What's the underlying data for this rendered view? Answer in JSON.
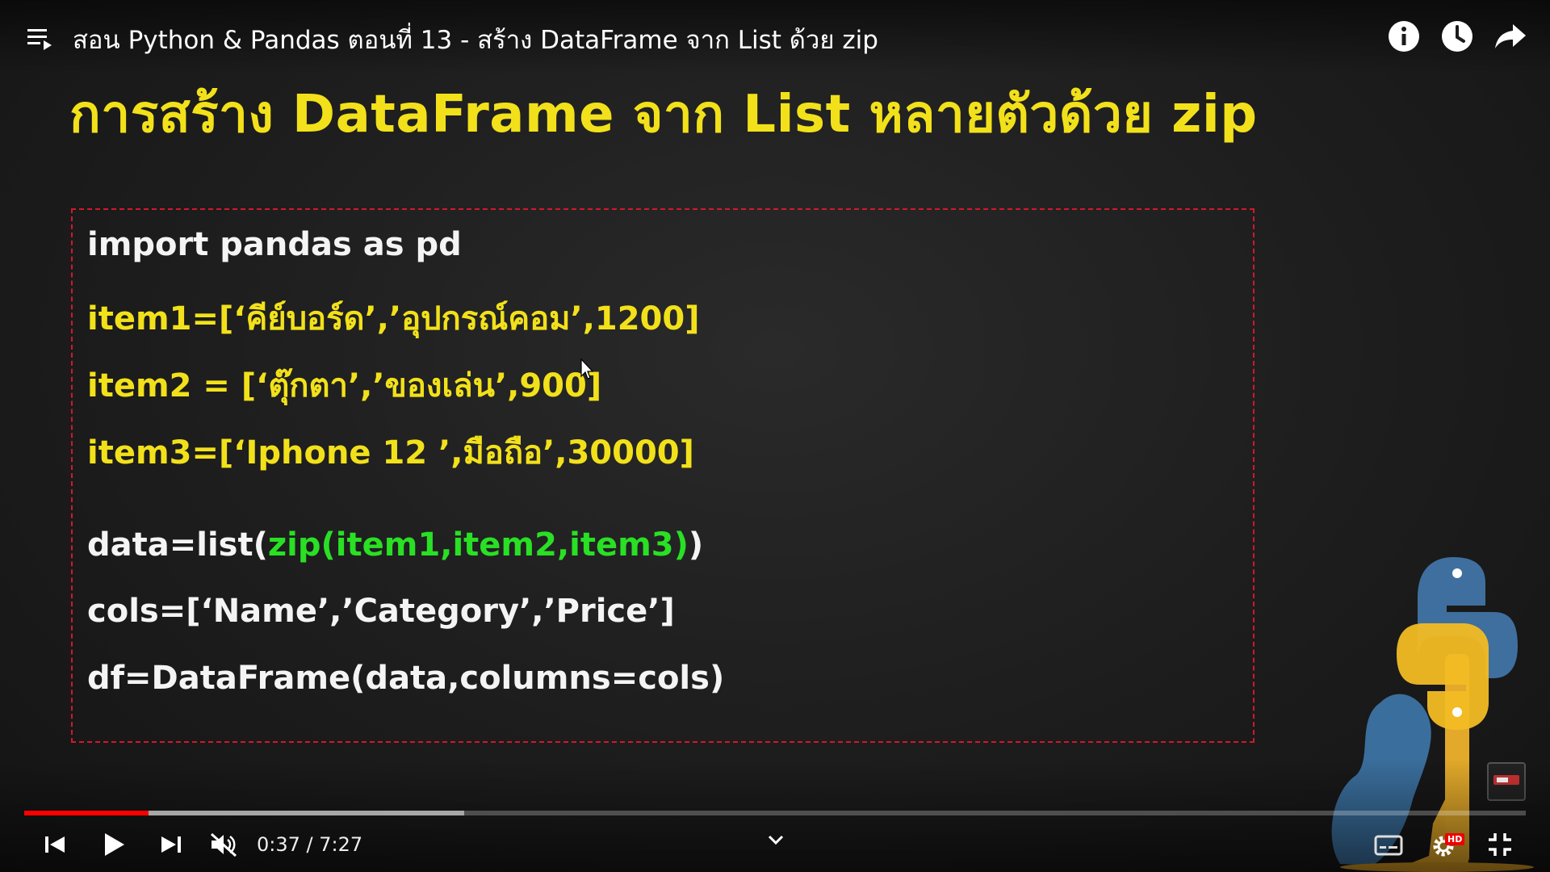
{
  "player": {
    "title": "สอน Python & Pandas ตอนที่ 13 - สร้าง DataFrame จาก List ด้วย zip",
    "current_time": "0:37",
    "duration": "7:27",
    "time_separator": " / ",
    "progress_played": 0.083,
    "progress_buffered": 0.293,
    "hd_label": "HD",
    "accent_color": "#ff0000"
  },
  "slide": {
    "heading": "การสร้าง DataFrame จาก List หลายตัวด้วย zip",
    "code": {
      "import": "import pandas as pd",
      "item1": "item1=[‘คีย์บอร์ด’,’อุปกรณ์คอม’,1200]",
      "item2": "item2 = [‘ตุ๊กตา’,’ของเล่น’,900]",
      "item3": "item3=[‘Iphone 12 ’,มือถือ’,30000]",
      "data_prefix": "data=list(",
      "data_zip": "zip(item1,item2,item3)",
      "data_suffix": ")",
      "cols": "cols=[‘Name’,’Category’,’Price’]",
      "df": "df=DataFrame(data,columns=cols)"
    },
    "colors": {
      "heading": "#f2e11a",
      "code_white": "#f4f4f4",
      "code_yellow": "#f2e11a",
      "code_green": "#29e024",
      "box_border": "#d0192a"
    }
  },
  "icons": {
    "playlist": "playlist-icon",
    "info": "info-icon",
    "watch_later": "clock-icon",
    "share": "share-arrow-icon",
    "previous": "skip-previous-icon",
    "play": "play-icon",
    "next": "skip-next-icon",
    "mute": "volume-muted-icon",
    "chevron": "chevron-down-icon",
    "captions": "captions-icon",
    "settings": "gear-icon",
    "fullscreen_exit": "fullscreen-exit-icon",
    "mascot": "python-logo-icon"
  }
}
